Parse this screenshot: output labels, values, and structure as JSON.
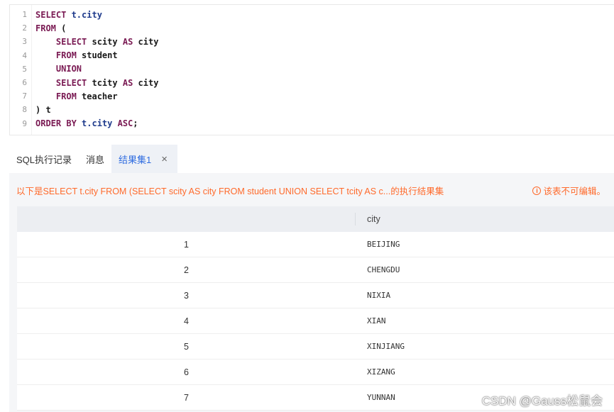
{
  "editor": {
    "lines": [
      {
        "num": "1",
        "tokens": [
          {
            "t": "SELECT ",
            "c": "kw"
          },
          {
            "t": "t.city",
            "c": "id"
          }
        ]
      },
      {
        "num": "2",
        "tokens": [
          {
            "t": "FROM ",
            "c": "kw"
          },
          {
            "t": "(",
            "c": ""
          }
        ]
      },
      {
        "num": "3",
        "tokens": [
          {
            "t": "    SELECT ",
            "c": "kw"
          },
          {
            "t": "scity ",
            "c": ""
          },
          {
            "t": "AS ",
            "c": "kw"
          },
          {
            "t": "city",
            "c": ""
          }
        ]
      },
      {
        "num": "4",
        "tokens": [
          {
            "t": "    FROM ",
            "c": "kw"
          },
          {
            "t": "student",
            "c": ""
          }
        ]
      },
      {
        "num": "5",
        "tokens": [
          {
            "t": "    UNION",
            "c": "kw"
          }
        ]
      },
      {
        "num": "6",
        "tokens": [
          {
            "t": "    SELECT ",
            "c": "kw"
          },
          {
            "t": "tcity ",
            "c": ""
          },
          {
            "t": "AS ",
            "c": "kw"
          },
          {
            "t": "city",
            "c": ""
          }
        ]
      },
      {
        "num": "7",
        "tokens": [
          {
            "t": "    FROM ",
            "c": "kw"
          },
          {
            "t": "teacher",
            "c": ""
          }
        ]
      },
      {
        "num": "8",
        "tokens": [
          {
            "t": ") t",
            "c": ""
          }
        ]
      },
      {
        "num": "9",
        "tokens": [
          {
            "t": "ORDER BY ",
            "c": "kw"
          },
          {
            "t": "t.city ",
            "c": "id"
          },
          {
            "t": "ASC",
            "c": "kw"
          },
          {
            "t": ";",
            "c": ""
          }
        ]
      }
    ]
  },
  "tabs": {
    "history": "SQL执行记录",
    "messages": "消息",
    "result": "结果集1",
    "close_glyph": "×"
  },
  "result": {
    "notice": "以下是SELECT t.city FROM (SELECT scity AS city FROM student UNION SELECT tcity AS c...的执行结果集",
    "readonly_icon": "i",
    "readonly_text": "该表不可编辑。",
    "column": "city",
    "rows": [
      {
        "num": "1",
        "city": "BEIJING"
      },
      {
        "num": "2",
        "city": "CHENGDU"
      },
      {
        "num": "3",
        "city": "NIXIA"
      },
      {
        "num": "4",
        "city": "XIAN"
      },
      {
        "num": "5",
        "city": "XINJIANG"
      },
      {
        "num": "6",
        "city": "XIZANG"
      },
      {
        "num": "7",
        "city": "YUNNAN"
      }
    ]
  },
  "watermark": "CSDN @Gauss松鼠会",
  "colors": {
    "keyword": "#7a1a53",
    "identifier": "#1f3b8c",
    "notice": "#ff6a2b",
    "active_tab": "#2f6ce0"
  }
}
